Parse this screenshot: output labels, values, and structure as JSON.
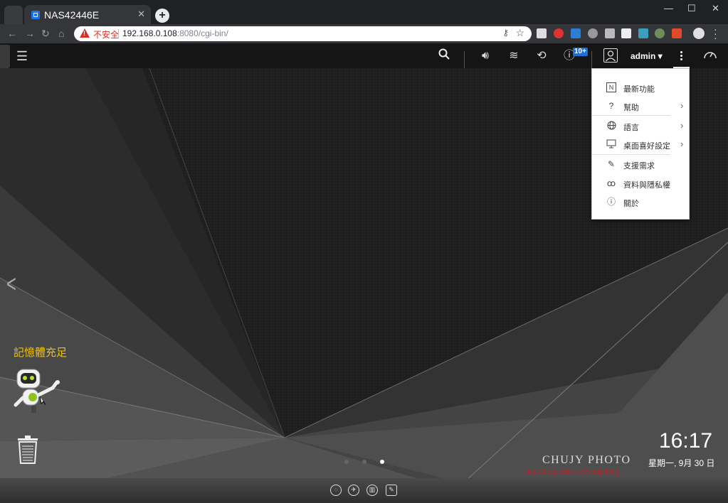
{
  "browser": {
    "tab_title": "NAS42446E",
    "new_tab": "+",
    "close_tab": "✕",
    "insecure_label": "不安全",
    "url_host": "192.168.0.108",
    "url_rest": ":8080/cgi-bin/"
  },
  "qts": {
    "badge_count": "10+",
    "user": "admin ▾",
    "menu": [
      {
        "icon": "new-features-icon",
        "label": "最新功能",
        "has_submenu": false
      },
      {
        "icon": "help-icon",
        "label": "幫助",
        "has_submenu": true
      },
      {
        "icon": "globe-icon",
        "label": "語言",
        "has_submenu": true
      },
      {
        "icon": "monitor-icon",
        "label": "桌面喜好設定",
        "has_submenu": true
      },
      {
        "icon": "support-icon",
        "label": "支援需求",
        "has_submenu": false
      },
      {
        "icon": "privacy-icon",
        "label": "資料與隱私權",
        "has_submenu": false
      },
      {
        "icon": "info-icon",
        "label": "關於",
        "has_submenu": false
      }
    ],
    "memory_status": "記憶體充足",
    "clock_time": "16:17",
    "clock_date": "星期一, 9月 30 日",
    "page_dots": {
      "count": 3,
      "active_index": 2
    },
    "watermark": "CHUJY PHOTO",
    "watermark_url": "http://blog.xuite.net/chujy/blog"
  },
  "colors": {
    "memory_text": "#f2c200",
    "badge": "#1c6fd6",
    "insecure": "#d93025"
  }
}
